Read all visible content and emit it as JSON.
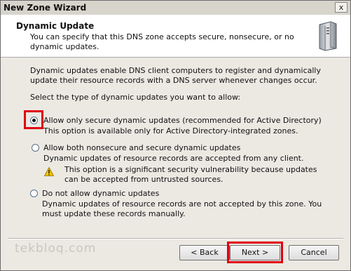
{
  "window": {
    "title": "New Zone Wizard",
    "close_glyph": "x"
  },
  "header": {
    "title": "Dynamic Update",
    "subtitle": "You can specify that this DNS zone accepts secure, nonsecure, or no dynamic updates.",
    "icon": "server-icon"
  },
  "body": {
    "intro": "Dynamic updates enable DNS client computers to register and dynamically update their resource records with a DNS server whenever changes occur.",
    "select_prompt": "Select the type of dynamic updates you want to allow:"
  },
  "options": [
    {
      "label": "Allow only secure dynamic updates (recommended for Active Directory)",
      "desc": "This option is available only for Active Directory-integrated zones.",
      "selected": true
    },
    {
      "label": "Allow both nonsecure and secure dynamic updates",
      "desc": "Dynamic updates of resource records are accepted from any client.",
      "warning": "This option is a significant security vulnerability because updates can be accepted from untrusted sources.",
      "selected": false
    },
    {
      "label": "Do not allow dynamic updates",
      "desc": "Dynamic updates of resource records are not accepted by this zone. You must update these records manually.",
      "selected": false
    }
  ],
  "watermark": "tekbloq.com",
  "buttons": {
    "back": "< Back",
    "next": "Next >",
    "cancel": "Cancel"
  },
  "colors": {
    "highlight": "#e00010"
  }
}
